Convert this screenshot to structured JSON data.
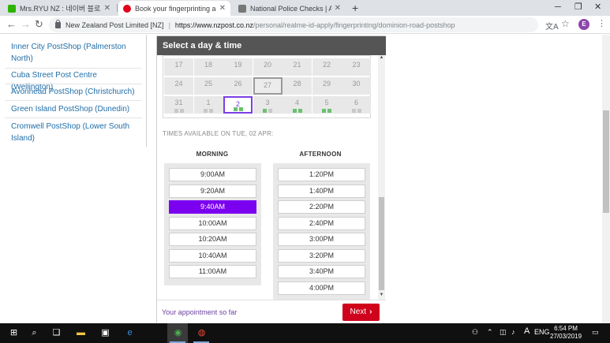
{
  "browser": {
    "tabs": [
      {
        "title": "Mrs.RYU NZ : 네이버 블로그",
        "active": false
      },
      {
        "title": "Book your fingerprinting appoint",
        "active": true
      },
      {
        "title": "National Police Checks | Australi",
        "active": false
      }
    ],
    "new_tab_symbol": "+",
    "url_origin": "New Zealand Post Limited [NZ]",
    "url_separator": "|",
    "url_scheme_host": "https://www.nzpost.co.nz",
    "url_path": "/personal/realme-id-apply/fingerprinting/dominion-road-postshop",
    "profile_initial": "E",
    "icons": {
      "back": "arrow-left-icon",
      "forward": "arrow-right-icon",
      "reload": "reload-icon",
      "lock": "lock-icon",
      "translate": "translate-icon",
      "bookmark": "star-icon",
      "menu": "kebab-menu-icon",
      "minimize": "minimize-icon",
      "maximize": "restore-icon",
      "close": "close-icon"
    }
  },
  "locations": [
    "Inner City PostShop (Palmerston North)",
    "Cuba Street Post Centre (Wellington)",
    "Avonhead PostShop (Christchurch)",
    "Green Island PostShop (Dunedin)",
    "Cromwell PostShop (Lower South Island)"
  ],
  "modal": {
    "title": "Select a day & time",
    "calendar": {
      "rows": [
        [
          {
            "d": "17"
          },
          {
            "d": "18"
          },
          {
            "d": "19"
          },
          {
            "d": "20"
          },
          {
            "d": "21"
          },
          {
            "d": "22"
          },
          {
            "d": "23"
          }
        ],
        [
          {
            "d": "24"
          },
          {
            "d": "25"
          },
          {
            "d": "26"
          },
          {
            "d": "27",
            "today": true
          },
          {
            "d": "28"
          },
          {
            "d": "29"
          },
          {
            "d": "30"
          }
        ],
        [
          {
            "d": "31",
            "dots": [
              "grey",
              "grey"
            ]
          },
          {
            "d": "1",
            "dots": [
              "grey",
              "grey"
            ]
          },
          {
            "d": "2",
            "dots": [
              "green",
              "green"
            ],
            "selected": true
          },
          {
            "d": "3",
            "dots": [
              "green",
              "grey"
            ]
          },
          {
            "d": "4",
            "dots": [
              "green",
              "green"
            ]
          },
          {
            "d": "5",
            "dots": [
              "green",
              "green"
            ]
          },
          {
            "d": "6",
            "dots": [
              "grey",
              "grey"
            ]
          }
        ]
      ],
      "dot_colors": {
        "green": "#6cc070",
        "grey": "#c8c8c8"
      }
    },
    "times_label": "TIMES AVAILABLE ON TUE, 02 APR:",
    "morning": {
      "heading": "MORNING",
      "slots": [
        "9:00AM",
        "9:20AM",
        "9:40AM",
        "10:00AM",
        "10:20AM",
        "10:40AM",
        "11:00AM"
      ],
      "selected_index": 2
    },
    "afternoon": {
      "heading": "AFTERNOON",
      "slots": [
        "1:20PM",
        "1:40PM",
        "2:20PM",
        "2:40PM",
        "3:00PM",
        "3:20PM",
        "3:40PM",
        "4:00PM"
      ]
    },
    "footer": {
      "summary_link": "Your appointment so far",
      "next_label": "Next",
      "next_icon": "chevron-right-icon"
    },
    "accent_color": "#7b00f0",
    "next_color": "#d0021b"
  },
  "taskbar": {
    "icons": [
      "windows-start-icon",
      "search-icon",
      "task-view-icon",
      "file-explorer-icon",
      "store-icon",
      "edge-icon",
      "chrome-icon",
      "app-icon"
    ],
    "tray_icons": [
      "people-icon",
      "chevron-up-icon",
      "network-icon",
      "volume-icon"
    ],
    "ime": "A",
    "language_indicator": "ENG",
    "time": "6:54 PM",
    "date": "27/03/2019"
  }
}
